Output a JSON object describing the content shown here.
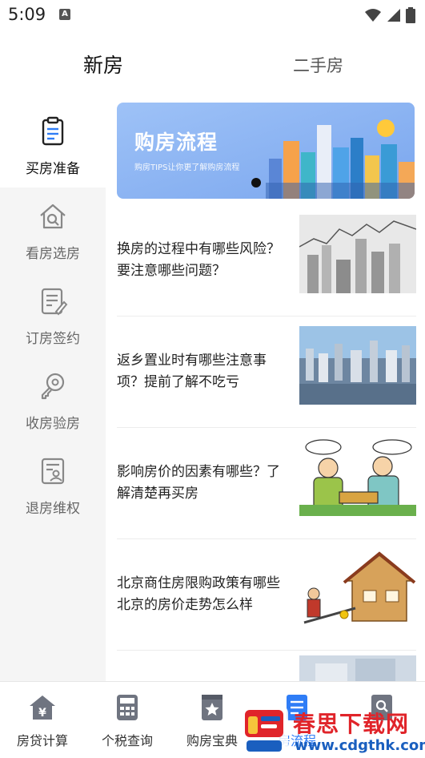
{
  "status": {
    "time": "5:09",
    "notification_icon": "A"
  },
  "tabs": [
    {
      "label": "新房",
      "active": true
    },
    {
      "label": "二手房",
      "active": false
    }
  ],
  "sidebar": {
    "items": [
      {
        "label": "买房准备",
        "icon": "clipboard-icon",
        "active": true
      },
      {
        "label": "看房选房",
        "icon": "house-search-icon",
        "active": false
      },
      {
        "label": "订房签约",
        "icon": "sign-document-icon",
        "active": false
      },
      {
        "label": "收房验房",
        "icon": "key-icon",
        "active": false
      },
      {
        "label": "退房维权",
        "icon": "rights-document-icon",
        "active": false
      }
    ]
  },
  "banner": {
    "title": "购房流程",
    "subtitle": "购房TIPS让你更了解购房流程"
  },
  "articles": [
    {
      "title": "换房的过程中有哪些风险？要注意哪些问题？",
      "thumb": "stock-chart-city-image"
    },
    {
      "title": "返乡置业时有哪些注意事项？提前了解不吃亏",
      "thumb": "city-aerial-image"
    },
    {
      "title": "影响房价的因素有哪些？了解清楚再买房",
      "thumb": "cartoon-negotiation-image"
    },
    {
      "title": "北京商住房限购政策有哪些北京的房价走势怎么样",
      "thumb": "house-lever-image"
    }
  ],
  "bottom_nav": {
    "items": [
      {
        "label": "房贷计算",
        "icon": "home-yuan-icon"
      },
      {
        "label": "个税查询",
        "icon": "calculator-icon"
      },
      {
        "label": "购房宝典",
        "icon": "book-star-icon"
      },
      {
        "label": "房流程",
        "icon": "list-icon"
      },
      {
        "label": "",
        "icon": "search-icon"
      }
    ]
  },
  "watermark": {
    "text": "春思下载网",
    "url": "www.cdgthk.com"
  },
  "colors": {
    "banner_bg": "#8fb6f3",
    "accent": "#2f7df6",
    "sidebar_bg": "#f5f5f5"
  }
}
